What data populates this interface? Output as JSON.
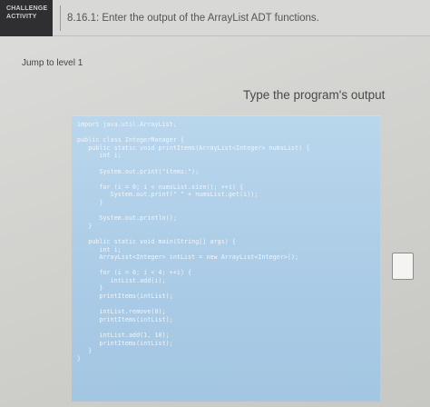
{
  "header": {
    "badge_line1": "CHALLENGE",
    "badge_line2": "ACTIVITY",
    "title": "8.16.1: Enter the output of the ArrayList ADT functions."
  },
  "jump_link": "Jump to level 1",
  "instructions": "Type the program's output",
  "code_lines": [
    "import java.util.ArrayList;",
    "",
    "public class IntegerManager {",
    "   public static void printItems(ArrayList<Integer> numsList) {",
    "      int i;",
    "",
    "      System.out.print(\"items:\");",
    "",
    "      for (i = 0; i < numsList.size(); ++i) {",
    "         System.out.print(\" \" + numsList.get(i));",
    "      }",
    "",
    "      System.out.println();",
    "   }",
    "",
    "   public static void main(String[] args) {",
    "      int i;",
    "      ArrayList<Integer> intList = new ArrayList<Integer>();",
    "",
    "      for (i = 0; i < 4; ++i) {",
    "         intList.add(i);",
    "      }",
    "      printItems(intList);",
    "",
    "      intList.remove(0);",
    "      printItems(intList);",
    "",
    "      intList.add(1, 10);",
    "      printItems(intList);",
    "   }",
    "}"
  ]
}
